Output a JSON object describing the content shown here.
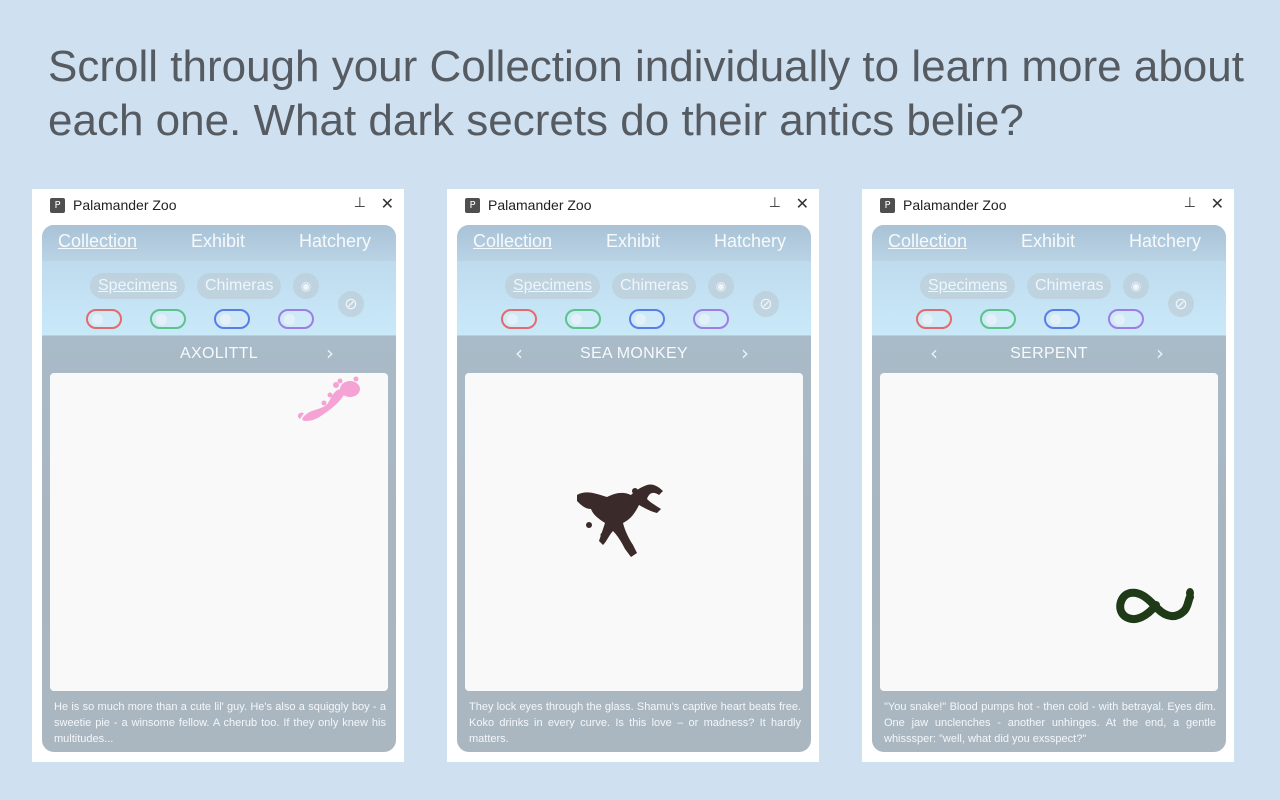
{
  "headline": "Scroll through your Collection individually to learn more about each one. What dark secrets do their antics belie?",
  "colors": {
    "background": "#cfe0f1",
    "toggle_red": "#e26b6b",
    "toggle_green": "#5bc48a",
    "toggle_blue": "#5b7ee6",
    "toggle_purple": "#9d7ee6",
    "axolotl": "#f5a3d4",
    "sea_monkey": "#3a2a29",
    "serpent": "#1f3a17"
  },
  "windows": [
    {
      "app_icon": "P",
      "title": "Palamander Zoo",
      "pin_icon": "pin-icon",
      "close_icon": "close-icon",
      "tabs": [
        "Collection",
        "Exhibit",
        "Hatchery"
      ],
      "filters": [
        "Specimens",
        "Chimeras"
      ],
      "species": "AXOLITTL",
      "has_prev": false,
      "has_next": true,
      "description": "He is so much more than a cute lil' guy. He's also a squiggly boy - a sweetie pie - a winsome fellow. A cherub too. If they only knew his multitudes..."
    },
    {
      "app_icon": "P",
      "title": "Palamander Zoo",
      "pin_icon": "pin-icon",
      "close_icon": "close-icon",
      "tabs": [
        "Collection",
        "Exhibit",
        "Hatchery"
      ],
      "filters": [
        "Specimens",
        "Chimeras"
      ],
      "species": "SEA MONKEY",
      "has_prev": true,
      "has_next": true,
      "description": "They lock eyes through the glass. Shamu's captive heart beats free. Koko drinks in every curve. Is this love – or madness? It hardly matters."
    },
    {
      "app_icon": "P",
      "title": "Palamander Zoo",
      "pin_icon": "pin-icon",
      "close_icon": "close-icon",
      "tabs": [
        "Collection",
        "Exhibit",
        "Hatchery"
      ],
      "filters": [
        "Specimens",
        "Chimeras"
      ],
      "species": "SERPENT",
      "has_prev": true,
      "has_next": true,
      "description": "\"You snake!\" Blood pumps hot - then cold - with betrayal. Eyes dim. One jaw unclenches - another unhinges. At the end, a gentle whisssper: \"well, what did you exsspect?\""
    }
  ]
}
